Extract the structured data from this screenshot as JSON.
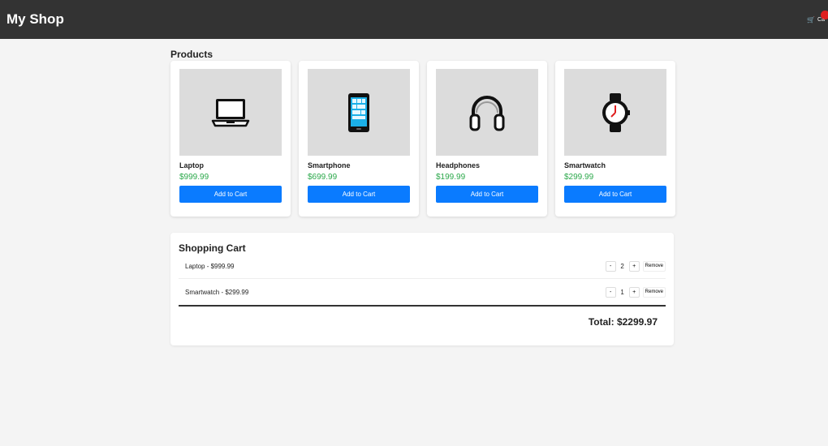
{
  "header": {
    "brand": "My Shop",
    "cart_label": "Ca",
    "cart_icon": "cart-icon",
    "badge_color": "#e02020"
  },
  "products": {
    "title": "Products",
    "items": [
      {
        "name": "Laptop",
        "price": "$999.99",
        "button": "Add to Cart",
        "icon": "laptop-icon"
      },
      {
        "name": "Smartphone",
        "price": "$699.99",
        "button": "Add to Cart",
        "icon": "smartphone-icon"
      },
      {
        "name": "Headphones",
        "price": "$199.99",
        "button": "Add to Cart",
        "icon": "headphones-icon"
      },
      {
        "name": "Smartwatch",
        "price": "$299.99",
        "button": "Add to Cart",
        "icon": "smartwatch-icon"
      }
    ]
  },
  "cart": {
    "title": "Shopping Cart",
    "items": [
      {
        "label": "Laptop - $999.99",
        "qty": "2",
        "minus": "-",
        "plus": "+",
        "remove": "Remove"
      },
      {
        "label": "Smartwatch - $299.99",
        "qty": "1",
        "minus": "-",
        "plus": "+",
        "remove": "Remove"
      }
    ],
    "total": "Total: $2299.97"
  },
  "colors": {
    "topbar": "#333333",
    "accent_button": "#0a7bff",
    "price": "#2aa84a",
    "background": "#f4f4f4"
  }
}
